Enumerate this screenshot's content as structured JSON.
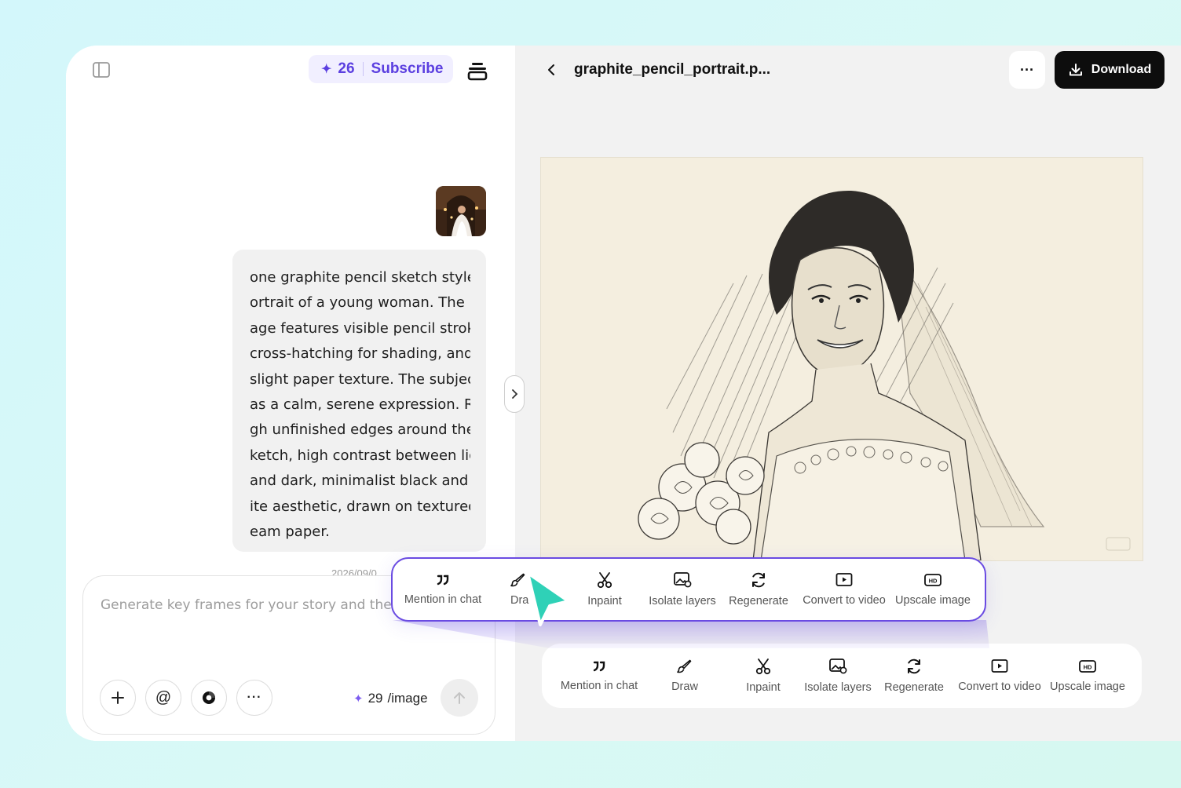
{
  "header": {
    "credits": "26",
    "subscribe_label": "Subscribe"
  },
  "chat": {
    "prompt_lines": [
      "one graphite pencil sketch style p",
      "ortrait of a young woman. The im",
      "age features visible pencil strokes,",
      "cross-hatching for shading, and a",
      "slight paper texture. The subject h",
      "as a calm, serene expression. Rou",
      "gh unfinished edges around the s",
      "ketch, high contrast between light",
      "and dark, minimalist black and wh",
      "ite aesthetic, drawn on textured cr",
      "eam paper."
    ],
    "timestamp": "2026/09/0"
  },
  "composer": {
    "placeholder": "Generate key frames for your story and then",
    "cost_value": "29",
    "cost_unit": "/image"
  },
  "viewer": {
    "file_title": "graphite_pencil_portrait.p...",
    "download_label": "Download",
    "more_label": "···"
  },
  "toolbar": {
    "tools": [
      {
        "label": "Mention in chat",
        "icon": "quote-icon"
      },
      {
        "label": "Draw",
        "icon": "brush-icon"
      },
      {
        "label": "Inpaint",
        "icon": "scissors-icon"
      },
      {
        "label": "Isolate layers",
        "icon": "image-layers-icon"
      },
      {
        "label": "Regenerate",
        "icon": "refresh-icon"
      },
      {
        "label": "Convert to video",
        "icon": "video-play-icon"
      },
      {
        "label": "Upscale image",
        "icon": "hd-icon"
      }
    ],
    "floating_partial_draw_label": "Dra"
  },
  "colors": {
    "accent": "#5b3fe0",
    "cursor": "#2fd1b7",
    "background": "#d3f7fb"
  }
}
